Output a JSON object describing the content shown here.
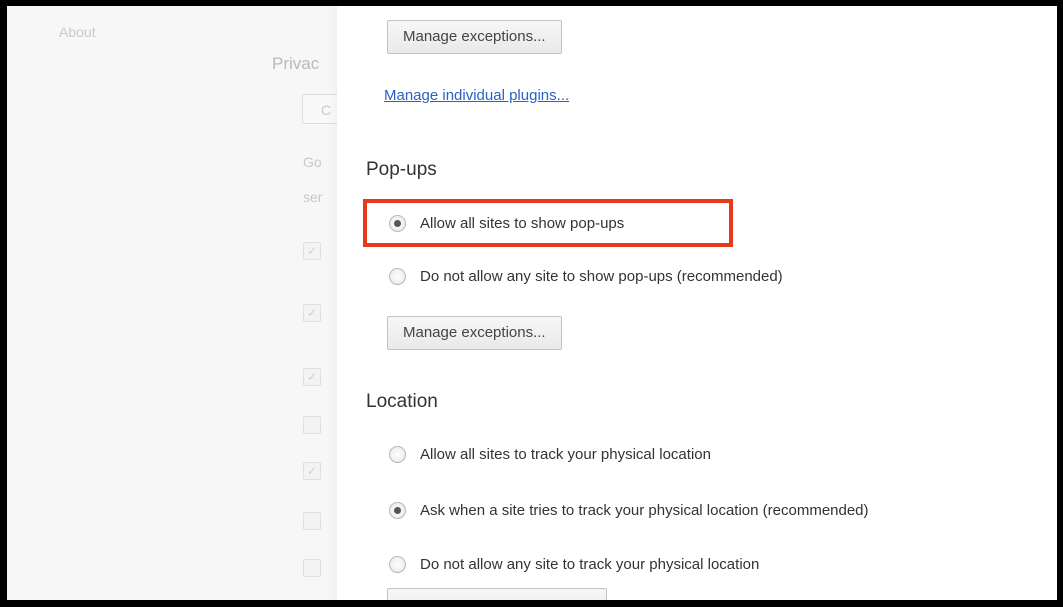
{
  "background": {
    "about_label": "About",
    "privacy_partial": "Privac",
    "button_partial": "C",
    "text_line1_partial": "Go",
    "text_line2_partial": "ser",
    "checkmark": "✓"
  },
  "plugins": {
    "manage_exceptions_label": "Manage exceptions...",
    "manage_individual_label": "Manage individual plugins..."
  },
  "popups": {
    "title": "Pop-ups",
    "options": [
      {
        "label": "Allow all sites to show pop-ups",
        "checked": true
      },
      {
        "label": "Do not allow any site to show pop-ups (recommended)",
        "checked": false
      }
    ],
    "manage_exceptions_label": "Manage exceptions..."
  },
  "location": {
    "title": "Location",
    "options": [
      {
        "label": "Allow all sites to track your physical location",
        "checked": false
      },
      {
        "label": "Ask when a site tries to track your physical location (recommended)",
        "checked": true
      },
      {
        "label": "Do not allow any site to track your physical location",
        "checked": false
      }
    ]
  },
  "colors": {
    "highlight": "#e8391d",
    "link": "#2a62c4"
  }
}
